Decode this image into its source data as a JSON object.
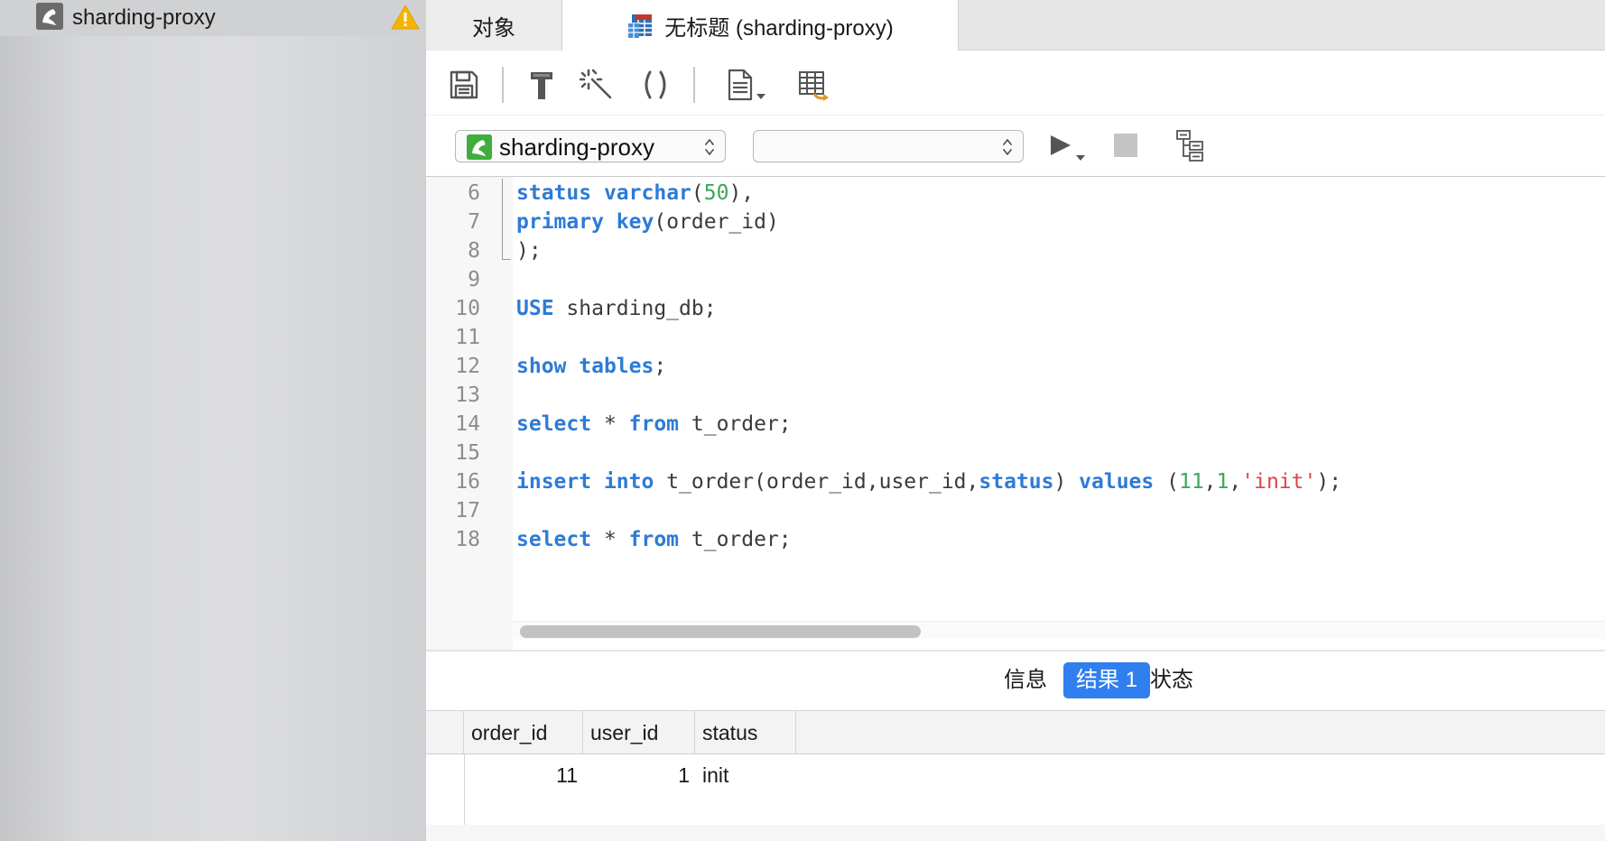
{
  "sidebar": {
    "connection_label": "sharding-proxy"
  },
  "tabs": {
    "objects_label": "对象",
    "query_label": "无标题 (sharding-proxy)"
  },
  "selectors": {
    "connection_value": "sharding-proxy",
    "database_value": ""
  },
  "editor": {
    "lines": [
      {
        "n": "6"
      },
      {
        "n": "7"
      },
      {
        "n": "8"
      },
      {
        "n": "9"
      },
      {
        "n": "10"
      },
      {
        "n": "11"
      },
      {
        "n": "12"
      },
      {
        "n": "13"
      },
      {
        "n": "14"
      },
      {
        "n": "15"
      },
      {
        "n": "16"
      },
      {
        "n": "17"
      },
      {
        "n": "18"
      }
    ],
    "code": {
      "l6_kw1": "status",
      "l6_kw2": "varchar",
      "l6_num": "50",
      "l6_t1": "(",
      "l6_t2": "),",
      "l7_kw1": "primary",
      "l7_kw2": "key",
      "l7_t1": "(order_id)",
      "l8_t1": ");",
      "l10_kw": "USE",
      "l10_t": " sharding_db;",
      "l12_kw1": "show",
      "l12_kw2": "tables",
      "l12_t": ";",
      "l14_kw1": "select",
      "l14_t1": " * ",
      "l14_kw2": "from",
      "l14_t2": " t_order;",
      "l16_kw1": "insert",
      "l16_kw2": "into",
      "l16_t1": " t_order(order_id,user_id,",
      "l16_kw3": "status",
      "l16_t2": ") ",
      "l16_kw4": "values",
      "l16_t3": " (",
      "l16_n1": "11",
      "l16_c1": ",",
      "l16_n2": "1",
      "l16_c2": ",",
      "l16_s": "'init'",
      "l16_t4": ");",
      "l18_kw1": "select",
      "l18_t1": " * ",
      "l18_kw2": "from",
      "l18_t2": " t_order;"
    },
    "horizontal_scroll_fraction": 0.37
  },
  "result_tabs": {
    "info": "信息",
    "result1": "结果 1",
    "status": "状态",
    "active": "result1"
  },
  "grid": {
    "columns": [
      "order_id",
      "user_id",
      "status"
    ],
    "rows": [
      {
        "order_id": "11",
        "user_id": "1",
        "status": "init"
      }
    ]
  },
  "colors": {
    "keyword": "#2e7bd6",
    "number": "#3aa85c",
    "string": "#e0434d",
    "active_tab": "#2f7fee",
    "warning": "#f5b400",
    "connection_green": "#3fae3c"
  },
  "icons": {
    "sidebar_connection": "mysql-dolphin-icon",
    "sidebar_warning": "warning-icon",
    "query_tab": "query-table-icon",
    "save": "save-icon",
    "build": "hammer-icon",
    "beautify": "magic-wand-icon",
    "parentheses": "parentheses-icon",
    "code_snippet": "document-icon",
    "export": "table-export-icon",
    "run": "play-icon",
    "stop": "stop-icon",
    "explain": "explain-tree-icon"
  }
}
